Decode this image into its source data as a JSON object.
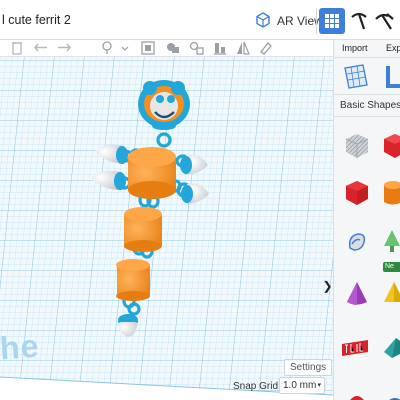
{
  "document": {
    "title": "l cute ferrit 2"
  },
  "topbar": {
    "ar_viewer_label": "AR Viewer",
    "icons": [
      "ar-cube-icon",
      "grid-view-icon",
      "pickaxe-icon",
      "hammer-pick-icon"
    ]
  },
  "toolbar": {
    "icons": [
      "delete-icon",
      "undo-icon",
      "redo-icon",
      "light-bulb-icon",
      "show-all-icon",
      "group-icon",
      "ungroup-icon",
      "align-icon",
      "mirror-icon",
      "cruise-icon"
    ]
  },
  "right_panel": {
    "import_label": "Import",
    "export_label": "Expo",
    "category_label": "Basic Shapes",
    "new_badge": "Ne",
    "shapes": [
      "box-hole",
      "box",
      "cylinder",
      "pyramid",
      "cone",
      "text",
      "roof",
      "sphere"
    ]
  },
  "workplane": {
    "watermark_text": "he",
    "settings_label": "Settings",
    "snap_grid_label": "Snap Grid",
    "snap_grid_value": "1.0 mm"
  },
  "colors": {
    "accent_blue": "#3d7fd9",
    "grid_blue": "#9fd0ea",
    "model_orange": "#f5901f",
    "model_blue": "#23a6d9",
    "model_white": "#e6e6e6",
    "shape_red": "#d8232a"
  }
}
